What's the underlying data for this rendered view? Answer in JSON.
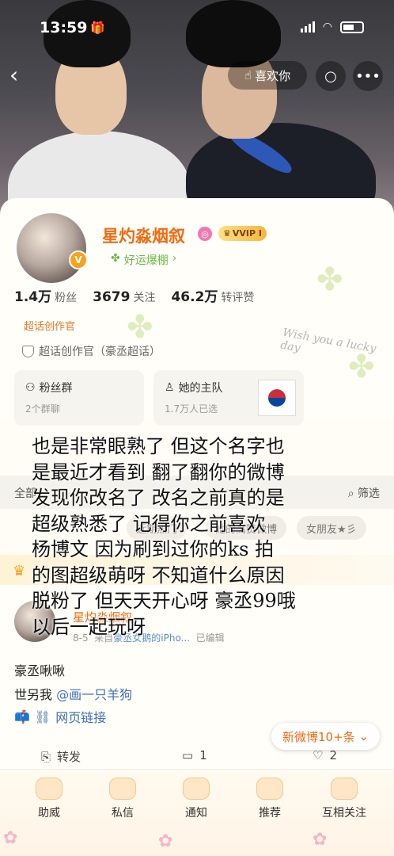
{
  "status": {
    "time": "13:59"
  },
  "nav": {
    "like_label": "喜欢你"
  },
  "profile": {
    "name": "星灼淼烟叙",
    "vip": "VVIP I",
    "subtitle": "好运爆棚",
    "stats": [
      {
        "value": "1.4万",
        "label": "粉丝"
      },
      {
        "value": "3679",
        "label": "关注"
      },
      {
        "value": "46.2万",
        "label": "转评赞"
      }
    ],
    "chaohua_title": "超话创作官",
    "chaohua_line": "超话创作官（豪丞超话）",
    "cards": [
      {
        "title": "粉丝群",
        "sub": "2个群聊"
      },
      {
        "title": "她的主队",
        "sub": "1.7万人已选"
      }
    ],
    "bg_text": "Wish you a lucky day"
  },
  "tabs": {
    "all": "全部",
    "filter": "筛选"
  },
  "chips": [
    "近期热门",
    "她的高赞微博",
    "女朋友★彡"
  ],
  "overlay_lines": [
    "也是非常眼熟了 但这个名字也",
    "是最近才看到 翻了翻你的微博",
    "发现你改名了 改名之前真的是",
    "超级熟悉了 记得你之前喜欢",
    "杨博文 因为刷到过你的ks 拍",
    "的图超级萌呀 不知道什么原因",
    "脱粉了 但天天开心呀 豪丞99哦",
    "以后一起玩呀"
  ],
  "post": {
    "author": "星灼淼烟叙",
    "date": "8-5",
    "from_prefix": "来自",
    "source": "豪丞女鹅的iPho...",
    "edited": "已编辑",
    "text1": "豪丞啾啾",
    "text2_prefix": "世另我",
    "mention": "@画一只羊狗",
    "link": "网页链接",
    "new_posts": "新微博10+条",
    "repost": "转发",
    "comments": "1",
    "likes": "2"
  },
  "bottom_tabs": [
    "助威",
    "私信",
    "通知",
    "推荐",
    "互相关注"
  ]
}
